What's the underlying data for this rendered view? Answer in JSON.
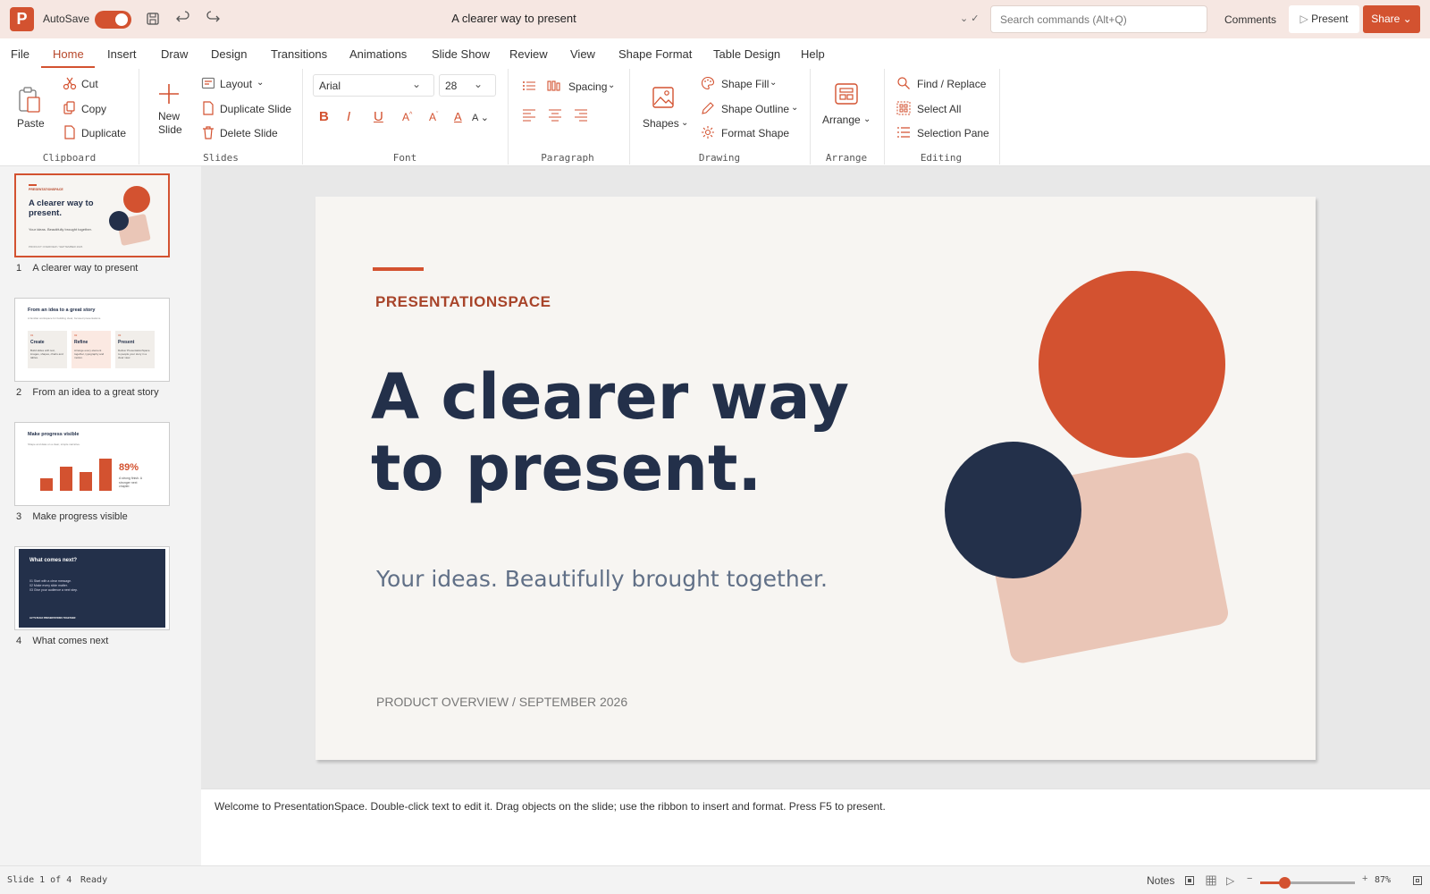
{
  "app": {
    "logo_letter": "P",
    "autosave_label": "AutoSave",
    "doc_title": "A clearer way to present",
    "saved_mark": "⌄ ✓",
    "search_placeholder": "Search commands (Alt+Q)",
    "comments_label": "Comments",
    "present_label": "Present",
    "share_label": "Share",
    "accent_color": "#d35230"
  },
  "tabs": [
    "File",
    "Home",
    "Insert",
    "Draw",
    "Design",
    "Transitions",
    "Animations",
    "Slide Show",
    "Review",
    "View",
    "Shape Format",
    "Table Design",
    "Help"
  ],
  "active_tab": "Home",
  "ribbon": {
    "clipboard": {
      "label": "Clipboard",
      "paste": "Paste",
      "cut": "Cut",
      "copy": "Copy",
      "duplicate": "Duplicate"
    },
    "slides": {
      "label": "Slides",
      "new_slide_line1": "New",
      "new_slide_line2": "Slide",
      "layout": "Layout",
      "duplicate_slide": "Duplicate Slide",
      "delete_slide": "Delete Slide"
    },
    "font": {
      "label": "Font",
      "family": "Arial",
      "size": "28"
    },
    "paragraph": {
      "label": "Paragraph",
      "spacing": "Spacing"
    },
    "drawing": {
      "label": "Drawing",
      "shapes": "Shapes",
      "shape_fill": "Shape Fill",
      "shape_outline": "Shape Outline",
      "format_shape": "Format Shape"
    },
    "arrange": {
      "label": "Arrange",
      "arrange": "Arrange"
    },
    "editing": {
      "label": "Editing",
      "find_replace": "Find / Replace",
      "select_all": "Select All",
      "selection_pane": "Selection Pane"
    }
  },
  "thumbnails": [
    {
      "num": "1",
      "caption": "A clearer way to present",
      "title": "A clearer way to present.",
      "brand": "PRESENTATIONSPACE",
      "sub": "Your ideas. Beautifully brought together.",
      "foot": "PRODUCT OVERVIEW / SEPTEMBER 2026"
    },
    {
      "num": "2",
      "caption": "From an idea to a great story",
      "title": "From an idea to a great story",
      "sub": "A familiar workspace for building clear, focused presentations.",
      "cards": [
        {
          "n": "01",
          "t": "Create",
          "d": "Build slides with text, images, shapes, charts and tables."
        },
        {
          "n": "02",
          "t": "Refine",
          "d": "Arrange every element together, typography and motion."
        },
        {
          "n": "03",
          "t": "Present",
          "d": "Deliver PresentationSpace to people your story in a clear view."
        }
      ]
    },
    {
      "num": "3",
      "caption": "Make progress visible",
      "title": "Make progress visible",
      "sub": "Shape and data on a clear, simple narrative.",
      "bar_values": [
        30,
        58,
        45,
        78
      ],
      "stat": "89%",
      "stat_note": "A strong finish. A stronger next chapter."
    },
    {
      "num": "4",
      "caption": "What comes next",
      "title": "What comes next?",
      "lines": [
        "01 Start with a clear message.",
        "02 Make every slide matter.",
        "03 Give your audience a next step."
      ],
      "foot": "LET'S BUILD PRESENTATIONS TOGETHER"
    }
  ],
  "slide": {
    "brand": "PRESENTATIONSPACE",
    "title_line1": "A clearer way",
    "title_line2": "to present.",
    "subtitle": "Your ideas. Beautifully brought together.",
    "footer": "PRODUCT OVERVIEW / SEPTEMBER 2026",
    "colors": {
      "navy": "#23304a",
      "orange": "#d35230",
      "peach": "#eac6b7",
      "bg": "#f7f5f2"
    }
  },
  "notes": "Welcome to PresentationSpace. Double-click text to edit it. Drag objects on the slide; use the ribbon to insert and format. Press F5 to present.",
  "status": {
    "slide_count": "Slide 1 of 4",
    "state": "Ready",
    "notes_label": "Notes",
    "zoom": "87%",
    "zoom_fraction": 0.25
  }
}
